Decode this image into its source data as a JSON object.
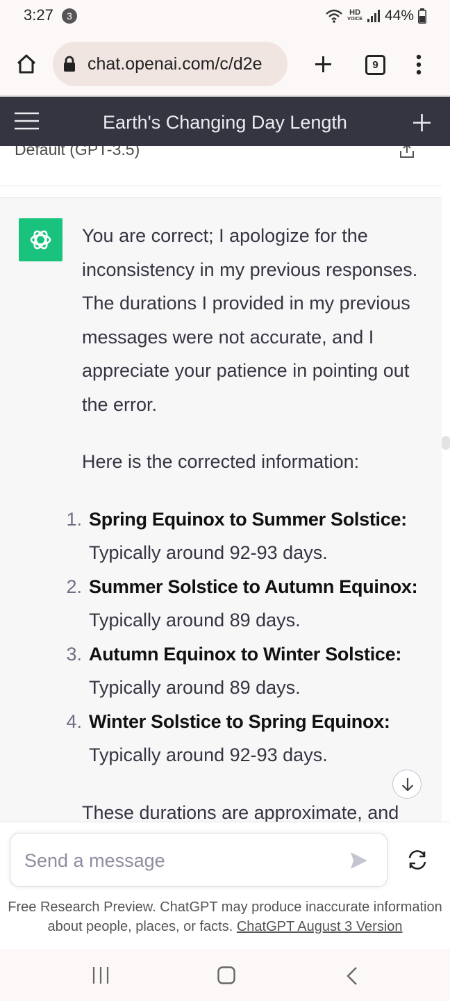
{
  "status_bar": {
    "time": "3:27",
    "notification_count": "3",
    "hd_label": "HD",
    "voice_label": "VOICE",
    "battery": "44%"
  },
  "browser": {
    "url": "chat.openai.com/c/d2e",
    "tab_count": "9"
  },
  "chat": {
    "title": "Earth's Changing Day Length",
    "model_label": "Default (GPT-3.5)",
    "paragraphs": [
      "You are correct; I apologize for the inconsistency in my previous responses. The durations I provided in my previous messages were not accurate, and I appreciate your patience in pointing out the error.",
      "Here is the corrected information:"
    ],
    "list": [
      {
        "number": "1.",
        "title": "Spring Equinox to Summer Solstice:",
        "detail": "Typically around 92-93 days."
      },
      {
        "number": "2.",
        "title": "Summer Solstice to Autumn Equinox:",
        "detail": "Typically around 89 days."
      },
      {
        "number": "3.",
        "title": "Autumn Equinox to Winter Solstice:",
        "detail": "Typically around 89 days."
      },
      {
        "number": "4.",
        "title": "Winter Solstice to Spring Equinox:",
        "detail": "Typically around 92-93 days."
      }
    ],
    "trailing_text": "These durations are approximate, and"
  },
  "composer": {
    "placeholder": "Send a message",
    "disclaimer": "Free Research Preview. ChatGPT may produce inaccurate information about people, places, or facts.",
    "version_link": "ChatGPT August 3 Version"
  },
  "colors": {
    "header_bg": "#343541",
    "avatar_bg": "#19c37d",
    "message_bg": "#f7f7f8"
  }
}
